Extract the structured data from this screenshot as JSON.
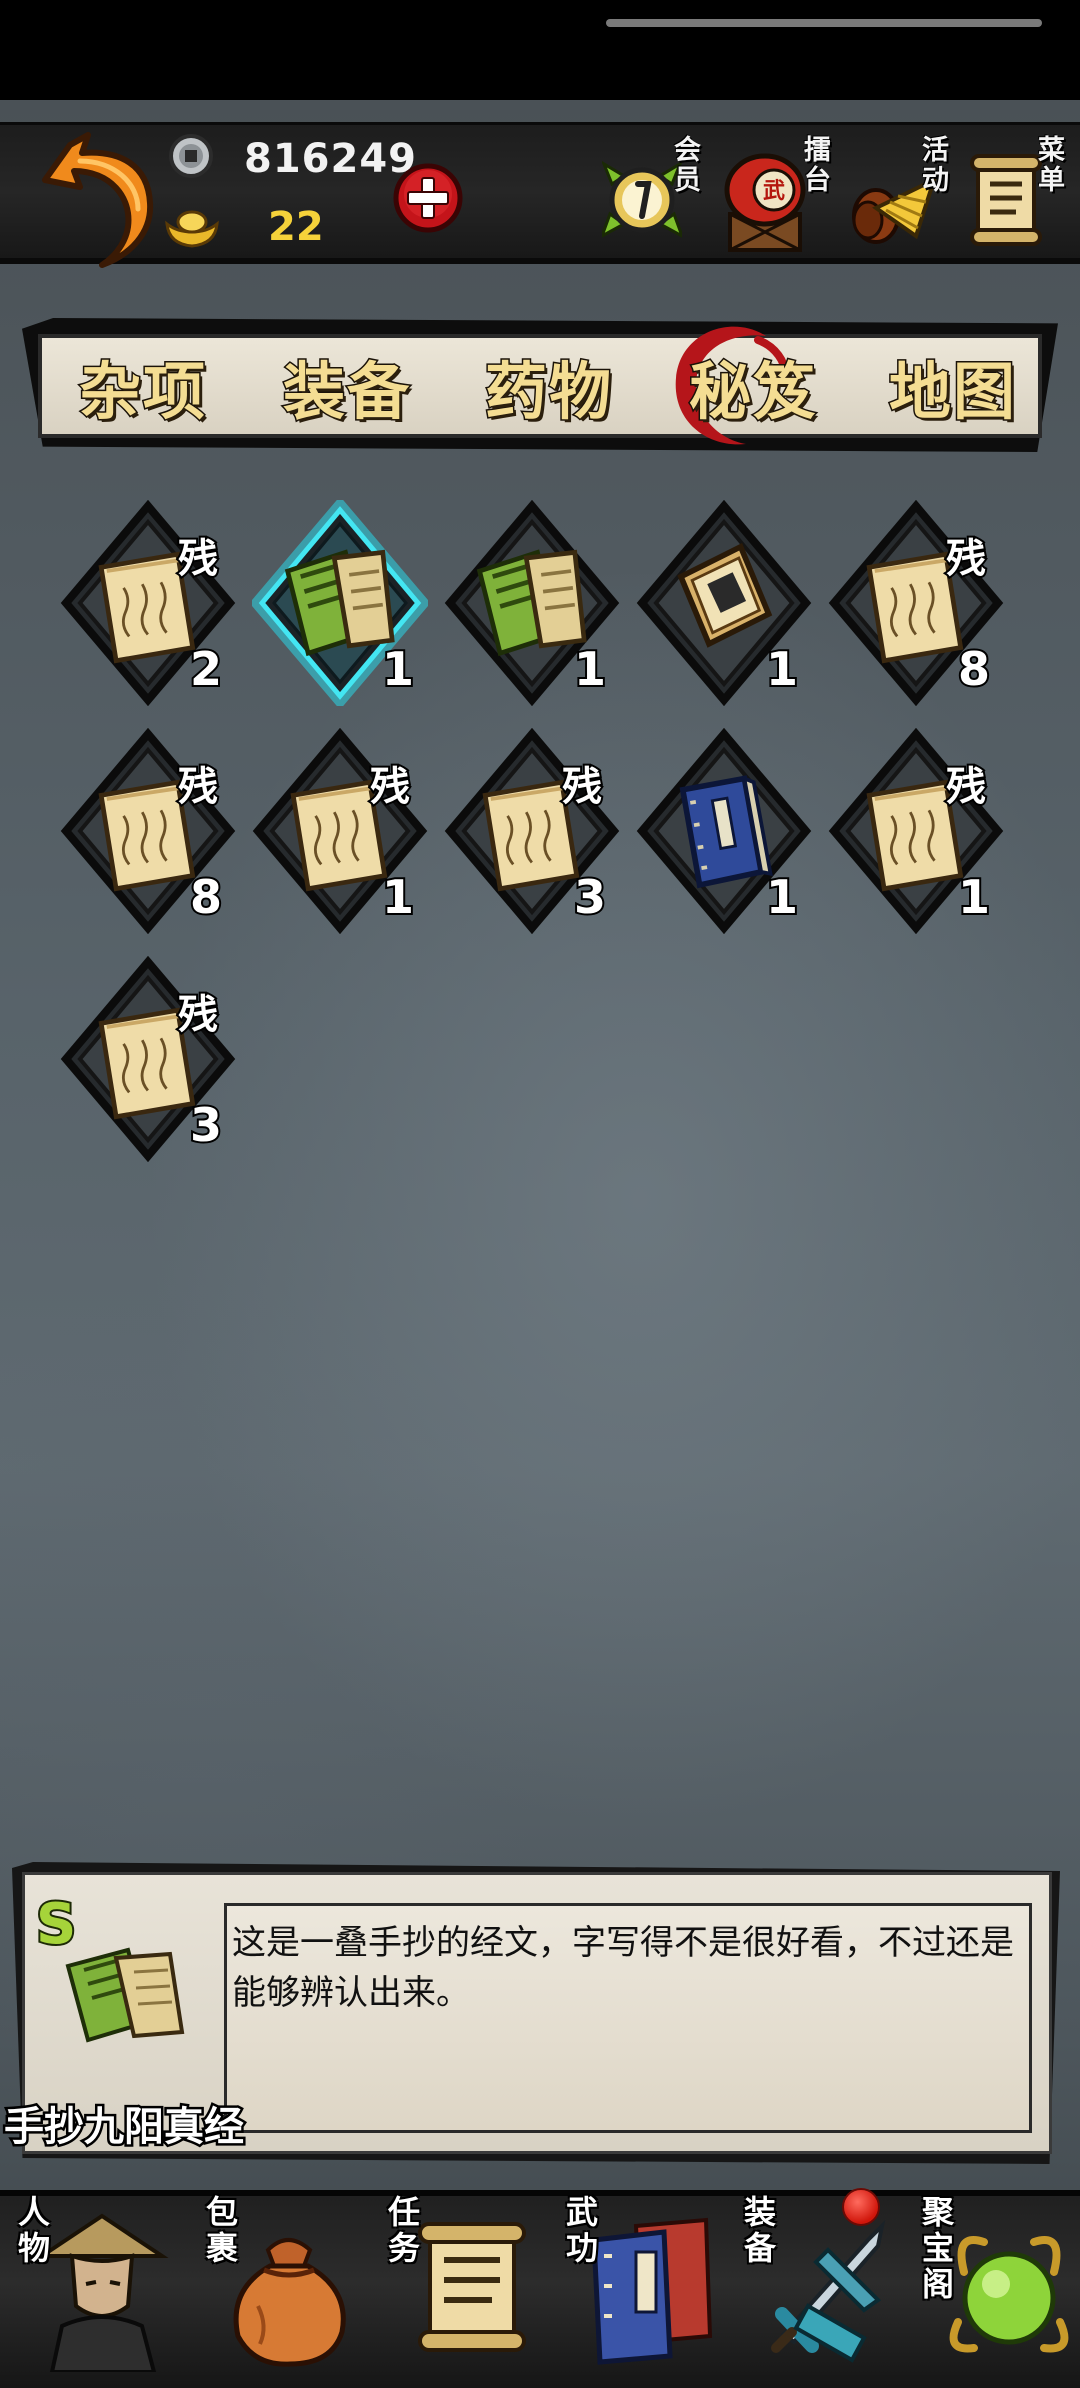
{
  "currency": {
    "silver": "816249",
    "gold": "22"
  },
  "top_nav": [
    {
      "label": "会员",
      "icon": "membership-medal-icon"
    },
    {
      "label": "擂台",
      "icon": "arena-drum-icon"
    },
    {
      "label": "活动",
      "icon": "event-hat-icon"
    },
    {
      "label": "菜单",
      "icon": "menu-scroll-icon"
    }
  ],
  "tabs": [
    {
      "label": "杂项",
      "active": false
    },
    {
      "label": "装备",
      "active": false
    },
    {
      "label": "药物",
      "active": false
    },
    {
      "label": "秘笈",
      "active": true
    },
    {
      "label": "地图",
      "active": false
    }
  ],
  "fragment_mark": "残",
  "inventory": [
    {
      "icon": "manual-fragment-icon",
      "quantity": "2",
      "fragment": true,
      "selected": false
    },
    {
      "icon": "green-manual-icon",
      "quantity": "1",
      "fragment": false,
      "selected": true
    },
    {
      "icon": "green-manual-icon",
      "quantity": "1",
      "fragment": false,
      "selected": false
    },
    {
      "icon": "sealed-scroll-icon",
      "quantity": "1",
      "fragment": false,
      "selected": false
    },
    {
      "icon": "manual-fragment-icon",
      "quantity": "8",
      "fragment": true,
      "selected": false
    },
    {
      "icon": "manual-fragment-icon",
      "quantity": "8",
      "fragment": true,
      "selected": false
    },
    {
      "icon": "manual-fragment-icon",
      "quantity": "1",
      "fragment": true,
      "selected": false
    },
    {
      "icon": "manual-fragment-icon",
      "quantity": "3",
      "fragment": true,
      "selected": false
    },
    {
      "icon": "blue-book-icon",
      "quantity": "1",
      "fragment": false,
      "selected": false
    },
    {
      "icon": "manual-fragment-icon",
      "quantity": "1",
      "fragment": true,
      "selected": false
    },
    {
      "icon": "manual-fragment-icon",
      "quantity": "3",
      "fragment": true,
      "selected": false
    }
  ],
  "selected_item": {
    "grade": "S",
    "name": "手抄九阳真经",
    "description": "这是一叠手抄的经文，字写得不是很好看，不过还是能够辨认出来。"
  },
  "bottom_nav": [
    {
      "label": "人物",
      "icon": "character-portrait-icon"
    },
    {
      "label": "包裹",
      "icon": "bag-icon"
    },
    {
      "label": "任务",
      "icon": "quest-scroll-icon"
    },
    {
      "label": "武功",
      "icon": "martial-arts-book-icon"
    },
    {
      "label": "装备",
      "icon": "equipment-sword-icon"
    },
    {
      "label": "聚宝阁",
      "icon": "treasure-shop-icon"
    }
  ],
  "colors": {
    "gold_text": "#f5d23a",
    "tab_text": "#f4dd93",
    "grade_s": "#a6d43a",
    "selected_glow": "#29d6e6"
  }
}
